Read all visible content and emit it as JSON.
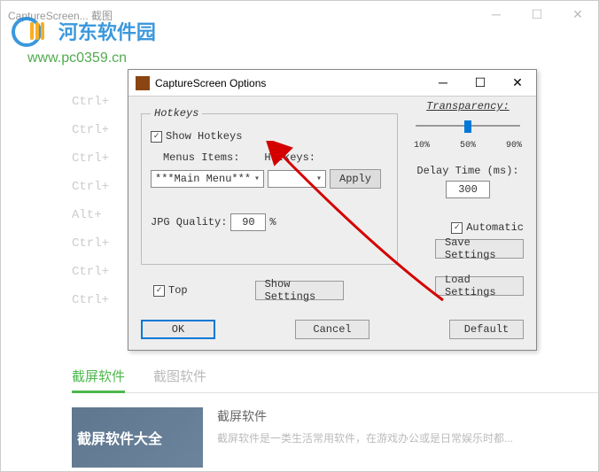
{
  "outer_window": {
    "title": "CaptureScreen... 截图"
  },
  "watermark": {
    "site_name": "河东软件园",
    "url": "www.pc0359.cn"
  },
  "bg_shortcuts": [
    "Ctrl+",
    "Ctrl+",
    "Ctrl+",
    "Ctrl+",
    "Alt+",
    "Ctrl+",
    "Ctrl+",
    "Ctrl+"
  ],
  "dialog": {
    "title": "CaptureScreen Options",
    "hotkeys_legend": "Hotkeys",
    "show_hotkeys": "Show Hotkeys",
    "menus_items_label": "Menus Items:",
    "menus_items_value": "***Main Menu***",
    "hotkeys_label": "Hotkeys:",
    "hotkeys_value": "",
    "apply": "Apply",
    "jpg_quality_label": "JPG Quality:",
    "jpg_quality_value": "90",
    "percent": "%",
    "transparency_label": "Transparency:",
    "trans_ticks": [
      "10%",
      "50%",
      "90%"
    ],
    "delay_label": "Delay Time (ms):",
    "delay_value": "300",
    "automatic": "Automatic",
    "save_settings": "Save Settings",
    "top": "Top",
    "show_settings": "Show Settings",
    "load_settings": "Load Settings",
    "ok": "OK",
    "cancel": "Cancel",
    "default": "Default"
  },
  "tabs": {
    "active": "截屏软件",
    "inactive": "截图软件"
  },
  "related": {
    "thumb_line1": "截屏软件大全",
    "title": "截屏软件",
    "desc": "截屏软件是一类生活常用软件，在游戏办公或是日常娱乐时都..."
  }
}
